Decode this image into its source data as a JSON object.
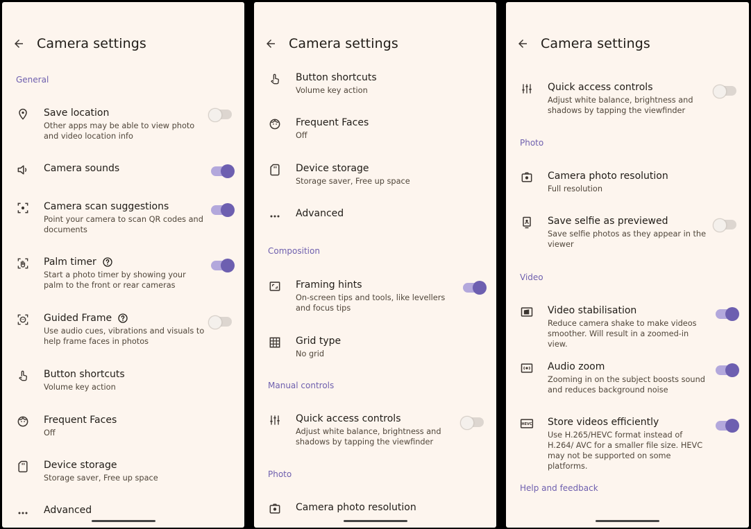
{
  "screen_title": "Camera settings",
  "sections": {
    "general": "General",
    "composition": "Composition",
    "manual_controls": "Manual controls",
    "photo": "Photo",
    "video": "Video",
    "help": "Help and feedback"
  },
  "items": {
    "save_location": {
      "title": "Save location",
      "subtitle": "Other apps may be able to view photo and video location info",
      "toggle": "off"
    },
    "camera_sounds": {
      "title": "Camera sounds",
      "toggle": "on"
    },
    "camera_scan": {
      "title": "Camera scan suggestions",
      "subtitle": "Point your camera to scan QR codes and documents",
      "toggle": "on"
    },
    "palm_timer": {
      "title": "Palm timer",
      "subtitle": "Start a photo timer by showing your palm to the front or rear cameras",
      "toggle": "on"
    },
    "guided_frame": {
      "title": "Guided Frame",
      "subtitle": "Use audio cues, vibrations and visuals to help frame faces in photos",
      "toggle": "off"
    },
    "button_shortcuts": {
      "title": "Button shortcuts",
      "subtitle": "Volume key action"
    },
    "frequent_faces": {
      "title": "Frequent Faces",
      "subtitle": "Off"
    },
    "device_storage": {
      "title": "Device storage",
      "subtitle": "Storage saver, Free up space"
    },
    "advanced": {
      "title": "Advanced"
    },
    "framing_hints": {
      "title": "Framing hints",
      "subtitle": "On-screen tips and tools, like levellers and focus tips",
      "toggle": "on"
    },
    "grid_type": {
      "title": "Grid type",
      "subtitle": "No grid"
    },
    "quick_access": {
      "title": "Quick access controls",
      "subtitle": "Adjust white balance, brightness and shadows by tapping the viewfinder",
      "toggle": "off"
    },
    "photo_resolution": {
      "title": "Camera photo resolution",
      "subtitle": "Full resolution"
    },
    "save_selfie": {
      "title": "Save selfie as previewed",
      "subtitle": "Save selfie photos as they appear in the viewer",
      "toggle": "off"
    },
    "video_stabilisation": {
      "title": "Video stabilisation",
      "subtitle": "Reduce camera shake to make videos smoother. Will result in a zoomed-in view.",
      "toggle": "on"
    },
    "audio_zoom": {
      "title": "Audio zoom",
      "subtitle": "Zooming in on the subject boosts sound and reduces background noise",
      "toggle": "on"
    },
    "store_efficiently": {
      "title": "Store videos efficiently",
      "subtitle": "Use H.265/HEVC format instead of H.264/ AVC for a smaller file size. HEVC may not be supported on some platforms.",
      "toggle": "on"
    }
  },
  "icons": {
    "hevc_label": "HEVC"
  },
  "colors": {
    "background": "#fdf5ee",
    "accent": "#6d5fb0",
    "section_label": "#6e5fae",
    "text_primary": "#1f1b16",
    "text_secondary": "#4f4539"
  }
}
